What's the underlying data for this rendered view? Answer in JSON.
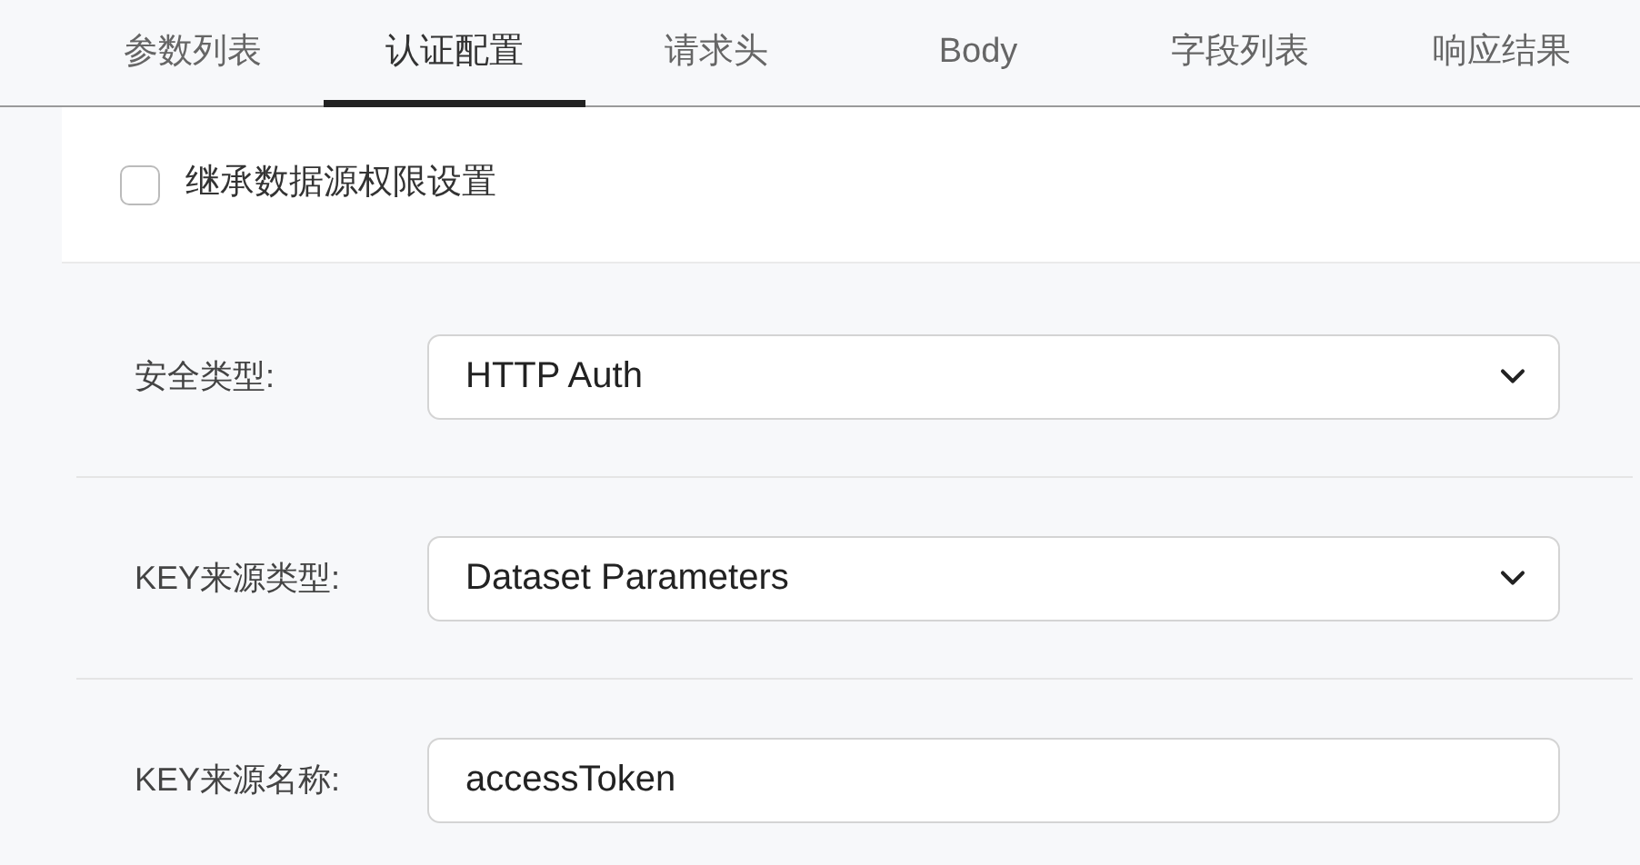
{
  "tabs": [
    {
      "label": "参数列表",
      "selected": false
    },
    {
      "label": "认证配置",
      "selected": true
    },
    {
      "label": "请求头",
      "selected": false
    },
    {
      "label": "Body",
      "selected": false
    },
    {
      "label": "字段列表",
      "selected": false
    },
    {
      "label": "响应结果",
      "selected": false
    }
  ],
  "inherit": {
    "label": "继承数据源权限设置",
    "checked": false
  },
  "fields": [
    {
      "label": "安全类型:",
      "kind": "select",
      "value": "HTTP Auth"
    },
    {
      "label": "KEY来源类型:",
      "kind": "select",
      "value": "Dataset Parameters"
    },
    {
      "label": "KEY来源名称:",
      "kind": "input",
      "value": "accessToken"
    }
  ]
}
